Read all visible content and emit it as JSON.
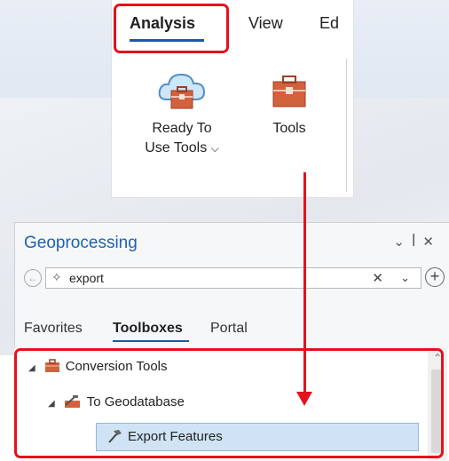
{
  "ribbon": {
    "tabs": [
      {
        "label": "Analysis"
      },
      {
        "label": "View"
      },
      {
        "label": "Ed"
      }
    ],
    "commands": {
      "ready_to_use_tools": {
        "line1": "Ready To",
        "line2": "Use Tools",
        "icon": "cloud-toolbox-icon"
      },
      "tools": {
        "label": "Tools",
        "icon": "toolbox-icon"
      }
    }
  },
  "geoprocessing": {
    "title": "Geoprocessing",
    "controls": {
      "dropdown": "⌄",
      "pin": "ᵖ",
      "close": "✕"
    },
    "search": {
      "value": "export"
    },
    "tabs": [
      "Favorites",
      "Toolboxes",
      "Portal"
    ],
    "tree": [
      {
        "label": "Conversion Tools",
        "icon": "toolbox-icon"
      },
      {
        "label": "To Geodatabase",
        "icon": "toolset-icon"
      },
      {
        "label": "Export Features",
        "icon": "hammer-icon",
        "selected": true
      }
    ]
  },
  "colors": {
    "accent": "#1e62b0",
    "highlight": "#e3121d",
    "selection": "#cfe3f5"
  }
}
